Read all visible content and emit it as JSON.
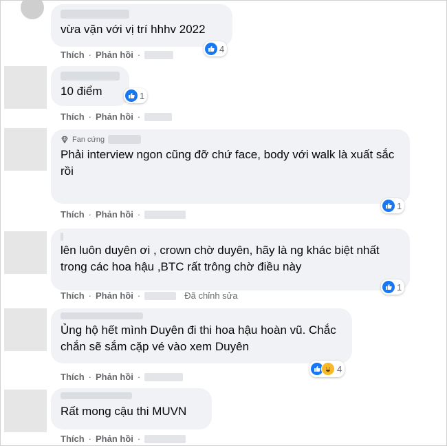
{
  "comments": [
    {
      "text": "vừa vặn với vị trí hhhv 2022",
      "reactions": "4"
    },
    {
      "text": "10 điểm",
      "reactions": "1"
    },
    {
      "badge": "Fan cứng",
      "text": "Phải interview ngon cũng đỡ chứ face, body với walk là xuất sắc rồi",
      "reactions": "1"
    },
    {
      "text": "lên luôn duyên ơi , crown chờ duyên, hãy là ng khác biệt nhất trong các hoa hậu ,BTC rất trông chờ điều này",
      "reactions": "1",
      "edited": "Đã chỉnh sửa"
    },
    {
      "text": "Ủng hộ hết mình Duyên đi thi hoa hậu hoàn vũ. Chắc chắn sẽ sắm cặp vé vào xem Duyên",
      "reactions": "4"
    },
    {
      "text": "Rất mong cậu thi MUVN"
    }
  ],
  "actions": {
    "like": "Thích",
    "reply": "Phản hồi",
    "separator": "·"
  },
  "icons": {
    "like": "like-icon",
    "haha": "haha-icon",
    "badge": "diamond-icon"
  },
  "colors": {
    "bubble": "#f0f2f5",
    "like": "#1877f2",
    "haha": "#f7b928",
    "meta": "#65676b"
  }
}
